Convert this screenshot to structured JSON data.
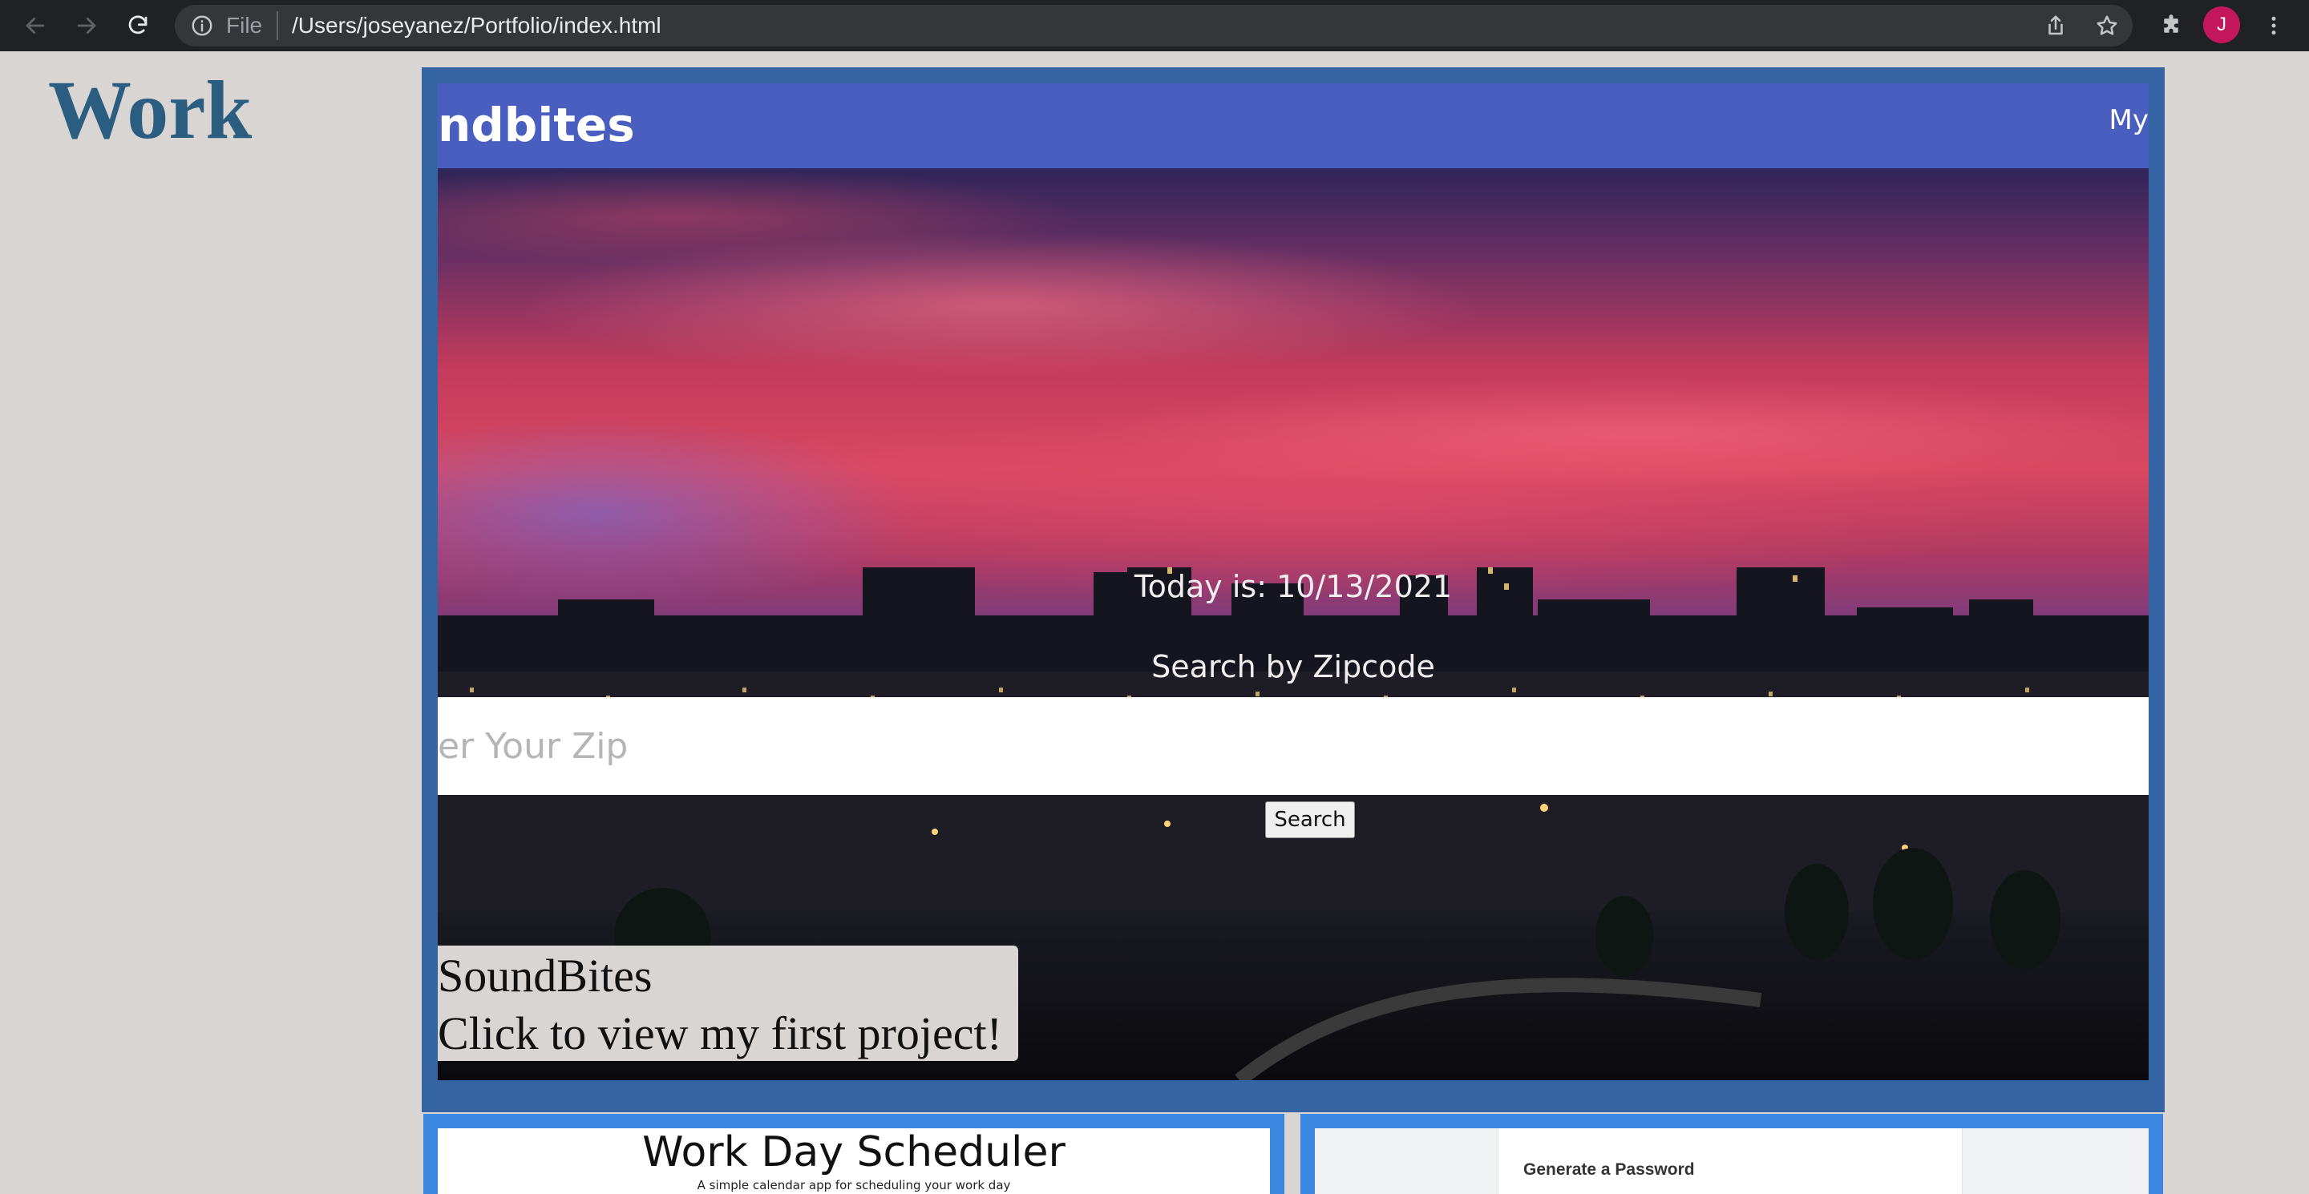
{
  "browser": {
    "scheme_label": "File",
    "url": "/Users/joseyanez/Portfolio/index.html",
    "avatar_letter": "J",
    "avatar_color": "#c2185b"
  },
  "page": {
    "heading": "Work",
    "heading_color": "#2a5d80"
  },
  "featured_project": {
    "screenshot": {
      "brand": "ndbites",
      "nav_link": "My",
      "date_text": "Today is: 10/13/2021",
      "search_label": "Search by Zipcode",
      "zip_placeholder": "er Your Zip",
      "search_button": "Search"
    },
    "label_title": "SoundBites",
    "label_caption": "Click to view my first project!"
  },
  "project_cards": [
    {
      "title": "Work Day Scheduler",
      "subtitle": "A simple calendar app for scheduling your work day"
    },
    {
      "title": "Generate a Password"
    }
  ],
  "colors": {
    "page_background": "#d9d5d2",
    "featured_border": "#3564a3",
    "navbar": "#4a5ec0",
    "card_border": "#3a86e0"
  },
  "icons": [
    "back-arrow-icon",
    "forward-arrow-icon",
    "reload-icon",
    "info-icon",
    "share-icon",
    "star-icon",
    "extensions-icon",
    "menu-dots-icon"
  ]
}
